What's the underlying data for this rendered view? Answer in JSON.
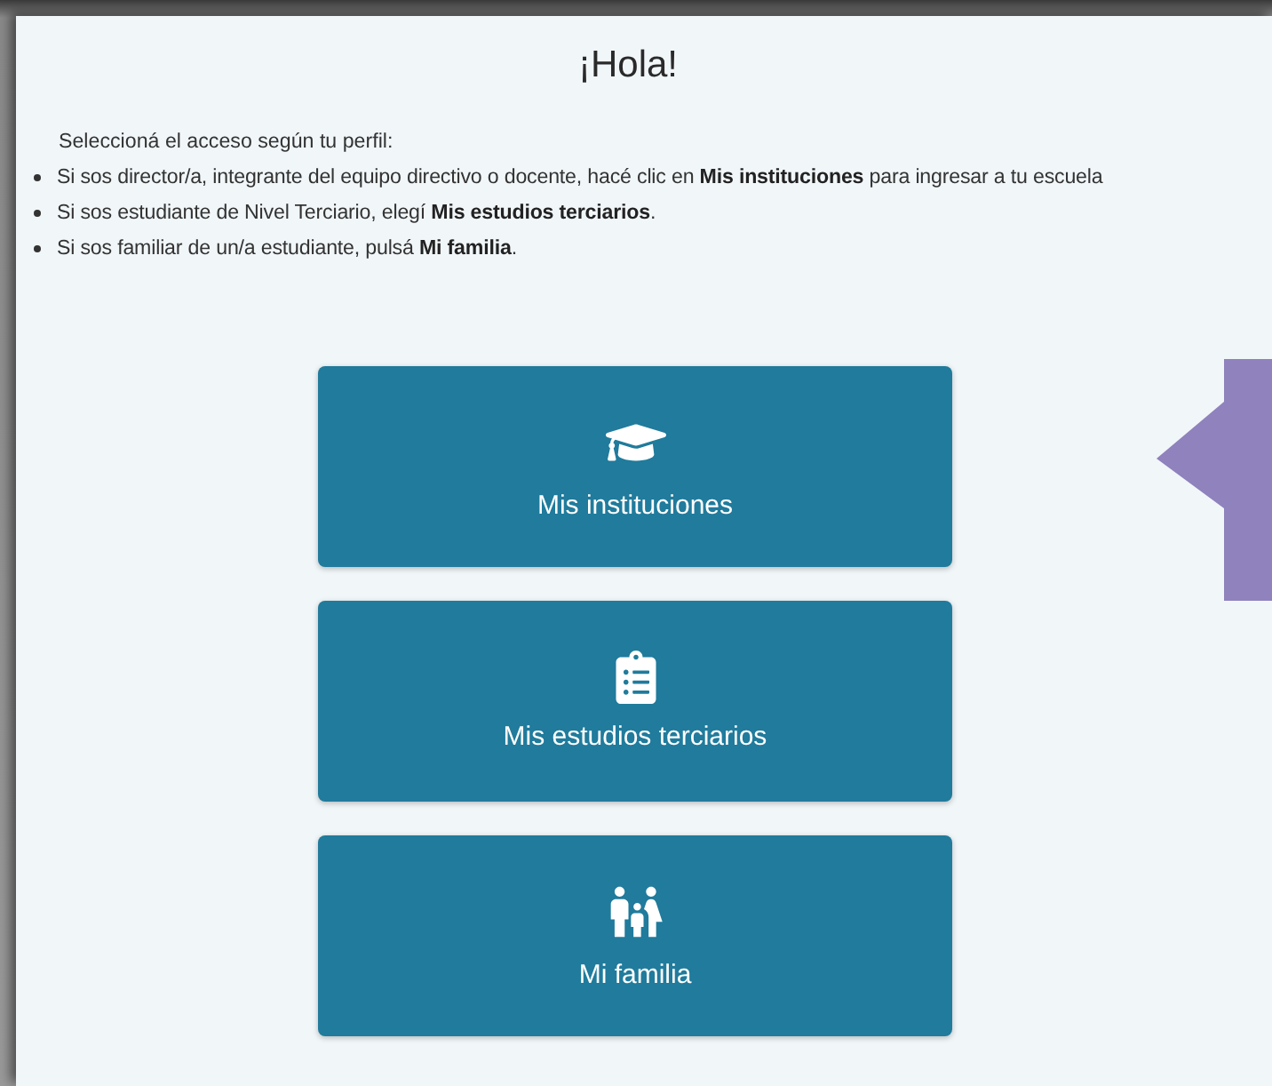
{
  "title": "¡Hola!",
  "intro": "Seleccioná el acceso según tu perfil:",
  "bullets": [
    "Si sos director/a, integrante del equipo directivo o docente, hacé clic en **Mis instituciones** para ingresar a tu escuela",
    "Si sos estudiante de Nivel Terciario, elegí **Mis estudios terciarios**.",
    "Si sos familiar de un/a estudiante, pulsá **Mi familia**."
  ],
  "buttons": [
    {
      "kind": "graduation",
      "label": "Mis instituciones"
    },
    {
      "kind": "clipboard",
      "label": "Mis estudios terciarios"
    },
    {
      "kind": "family",
      "label": "Mi familia"
    }
  ]
}
